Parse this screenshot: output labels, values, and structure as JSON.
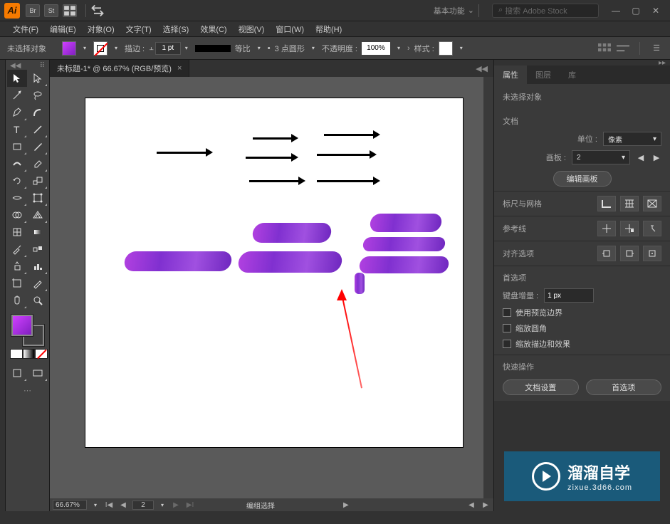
{
  "titlebar": {
    "logo": "Ai",
    "icon1": "Br",
    "icon2": "St",
    "workspace_label": "基本功能",
    "search_placeholder": "搜索 Adobe Stock",
    "search_icon": "🔍"
  },
  "menu": {
    "file": "文件(F)",
    "edit": "编辑(E)",
    "object": "对象(O)",
    "type": "文字(T)",
    "select": "选择(S)",
    "effect": "效果(C)",
    "view": "视图(V)",
    "window": "窗口(W)",
    "help": "帮助(H)"
  },
  "optbar": {
    "noselection": "未选择对象",
    "fill_color": "linear-gradient(135deg,#d040ff,#8020c0)",
    "stroke_color": "none",
    "stroke_label": "描边 :",
    "stroke_width": "1 pt",
    "uniform_label": "等比",
    "profile_label": "3 点圆形",
    "opacity_label": "不透明度 :",
    "opacity_value": "100%",
    "style_label": "样式 :"
  },
  "docs": {
    "tab1": "未标题-1* @ 66.67% (RGB/预览)"
  },
  "status": {
    "zoom": "66.67%",
    "page": "2",
    "selection_label": "编组选择"
  },
  "props": {
    "tabs": {
      "properties": "属性",
      "layers": "图层",
      "library": "库"
    },
    "noselection": "未选择对象",
    "doc_section": "文档",
    "unit_label": "单位 :",
    "unit_value": "像素",
    "artboard_label": "画板 :",
    "artboard_value": "2",
    "edit_artboard_btn": "编辑画板",
    "ruler_section": "标尺与网格",
    "guides_section": "参考线",
    "align_section": "对齐选项",
    "prefs_section": "首选项",
    "keyincrement_label": "键盘增量 :",
    "keyincrement_value": "1 px",
    "chk_preview": "使用预览边界",
    "chk_scalecorners": "缩放圆角",
    "chk_scalestrokes": "缩放描边和效果",
    "quick_section": "快速操作",
    "btn_docsetup": "文档设置",
    "btn_prefs": "首选项"
  },
  "watermark": {
    "line1": "溜溜自学",
    "line2": "zixue.3d66.com"
  },
  "chart_data": null
}
